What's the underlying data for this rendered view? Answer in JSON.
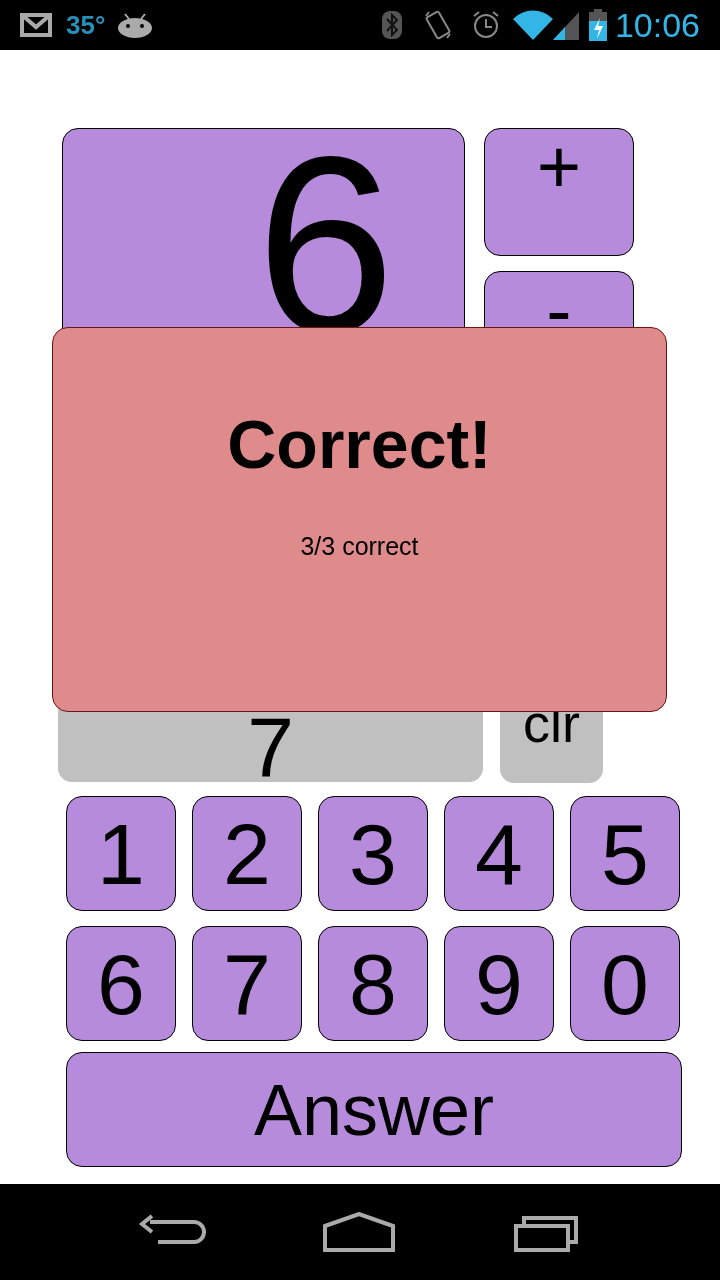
{
  "status_bar": {
    "temperature": "35°",
    "time": "10:06"
  },
  "problem": {
    "number": "6",
    "operators": [
      "+",
      "-"
    ]
  },
  "answer_field": {
    "value": "7"
  },
  "clear_button": "clr",
  "keypad": [
    "1",
    "2",
    "3",
    "4",
    "5",
    "6",
    "7",
    "8",
    "9",
    "0"
  ],
  "answer_button": "Answer",
  "dialog": {
    "title": "Correct!",
    "score": "3/3 correct"
  }
}
